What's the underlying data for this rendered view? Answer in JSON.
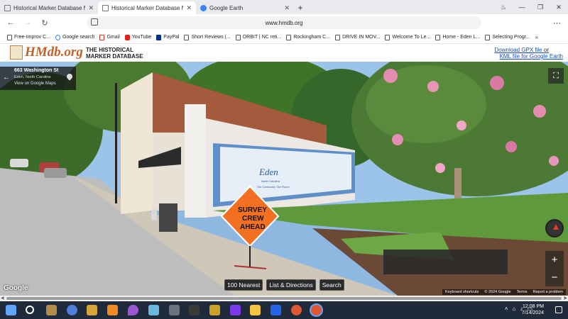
{
  "browser": {
    "tabs": [
      {
        "label": "Historical Marker Database Map",
        "active": false
      },
      {
        "label": "Historical Marker Database Map",
        "active": true
      },
      {
        "label": "Google Earth",
        "active": false
      }
    ],
    "url": "www.hmdb.org",
    "new_tab": "+",
    "menu": "⋯"
  },
  "bookmarks": [
    {
      "label": "Free-Improv C...",
      "icon": "page-icon"
    },
    {
      "label": "Google search",
      "icon": "google-icon"
    },
    {
      "label": "Gmail",
      "icon": "gmail-icon"
    },
    {
      "label": "YouTube",
      "icon": "youtube-icon"
    },
    {
      "label": "PayPal",
      "icon": "paypal-icon"
    },
    {
      "label": "Short Reviews (...",
      "icon": "bookmark-icon"
    },
    {
      "label": "ORBIT | NC reti...",
      "icon": "bookmark-icon"
    },
    {
      "label": "Rockingham C...",
      "icon": "bookmark-icon"
    },
    {
      "label": "DRIVE IN MOV...",
      "icon": "bookmark-icon"
    },
    {
      "label": "Welcome To Le...",
      "icon": "bookmark-icon"
    },
    {
      "label": "Home - Eden L...",
      "icon": "bookmark-icon"
    },
    {
      "label": "Selecting Progr...",
      "icon": "bookmark-icon"
    }
  ],
  "hmdb": {
    "logo": "HMdb.org",
    "title_line1": "THE HISTORICAL",
    "title_line2": "MARKER DATABASE",
    "link_gpx": "Download GPX file",
    "link_kml": "KML file for Google Earth",
    "link_separator": "or"
  },
  "streetview": {
    "address": "663 Washington St",
    "city": "Eden, North Carolina",
    "view_link": "View on Google Maps",
    "watermark": "Google",
    "attribution": [
      "Keyboard shortcuts",
      "© 2024 Google",
      "Terms",
      "Report a problem"
    ],
    "buttons": [
      "100 Nearest",
      "List & Directions",
      "Search"
    ],
    "scene": {
      "sign_text": [
        "SURVEY",
        "CREW",
        "AHEAD"
      ],
      "mural_title": "Eden",
      "mural_subtitle": "North Carolina",
      "mural_tagline": "Our Community. Our Future."
    }
  },
  "taskbar": {
    "time": "12:08 PM",
    "date": "7/14/2024"
  },
  "colors": {
    "hmdb_orange": "#c0632b",
    "link_blue": "#1a4fb8",
    "taskbar": "#1f2a3a"
  }
}
